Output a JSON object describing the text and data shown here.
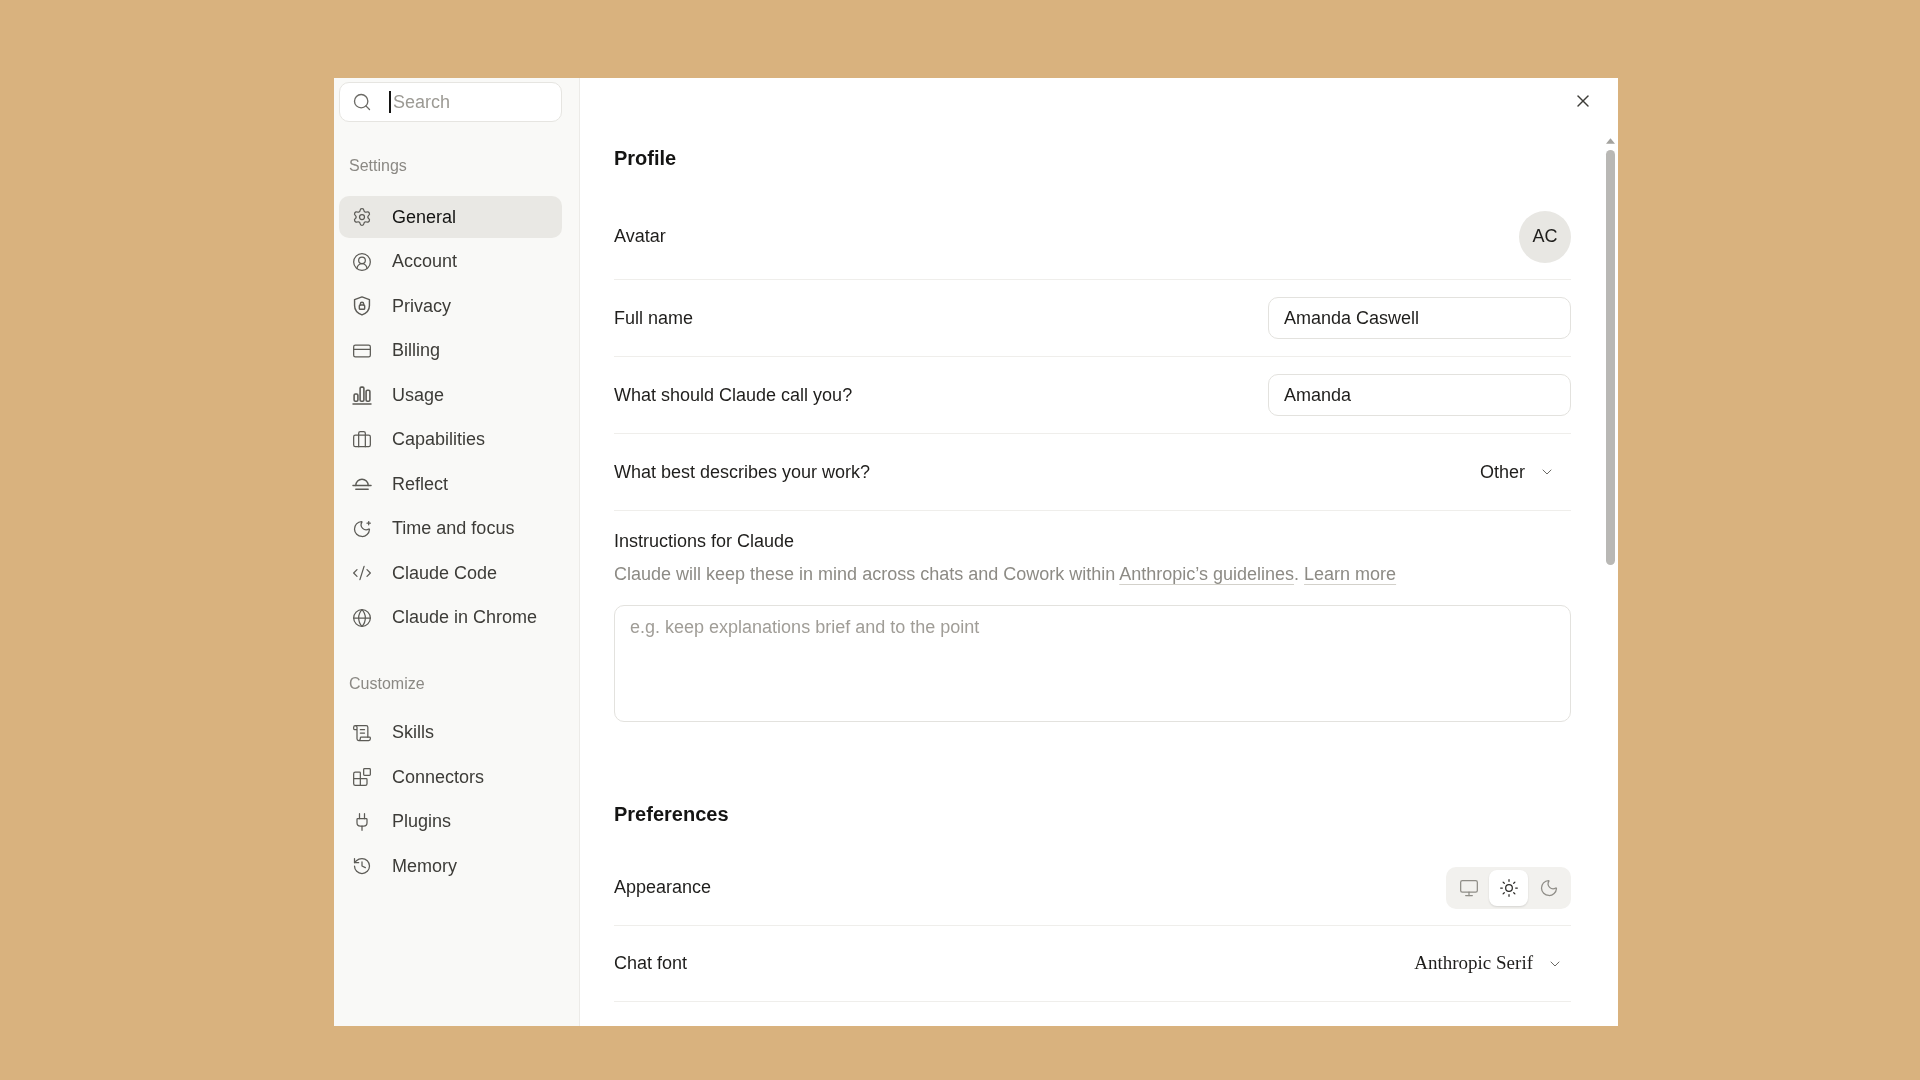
{
  "sidebar": {
    "search": {
      "placeholder": "Search",
      "focused": true
    },
    "sections": [
      {
        "title": "Settings",
        "items": [
          {
            "label": "General",
            "selected": true
          },
          {
            "label": "Account",
            "selected": false
          },
          {
            "label": "Privacy",
            "selected": false
          },
          {
            "label": "Billing",
            "selected": false
          },
          {
            "label": "Usage",
            "selected": false
          },
          {
            "label": "Capabilities",
            "selected": false
          },
          {
            "label": "Reflect",
            "selected": false
          },
          {
            "label": "Time and focus",
            "selected": false
          },
          {
            "label": "Claude Code",
            "selected": false
          },
          {
            "label": "Claude in Chrome",
            "selected": false
          }
        ]
      },
      {
        "title": "Customize",
        "items": [
          {
            "label": "Skills",
            "selected": false
          },
          {
            "label": "Connectors",
            "selected": false
          },
          {
            "label": "Plugins",
            "selected": false
          },
          {
            "label": "Memory",
            "selected": false
          }
        ]
      }
    ]
  },
  "content": {
    "sections": [
      {
        "title": "Profile",
        "rows": [
          {
            "kind": "avatar",
            "label": "Avatar",
            "initials": "AC"
          },
          {
            "kind": "text_input",
            "label": "Full name",
            "value": "Amanda Caswell"
          },
          {
            "kind": "text_input",
            "label": "What should Claude call you?",
            "value": "Amanda"
          },
          {
            "kind": "select",
            "label": "What best describes your work?",
            "value": "Other"
          },
          {
            "kind": "textarea",
            "label": "Instructions for Claude",
            "description": [
              {
                "kind": "text",
                "text": "Claude will keep these in mind across chats and Cowork within "
              },
              {
                "kind": "link",
                "text": "Anthropic’s guidelines"
              },
              {
                "kind": "text",
                "text": ". "
              },
              {
                "kind": "link",
                "text": "Learn more"
              }
            ],
            "placeholder": "e.g. keep explanations brief and to the point"
          }
        ]
      },
      {
        "title": "Preferences",
        "rows": [
          {
            "kind": "theme_toggle",
            "label": "Appearance",
            "options": [
              {
                "selected": false
              },
              {
                "selected": true
              },
              {
                "selected": false
              }
            ]
          },
          {
            "kind": "font_select",
            "label": "Chat font",
            "value": "Anthropic Serif"
          }
        ]
      }
    ]
  }
}
